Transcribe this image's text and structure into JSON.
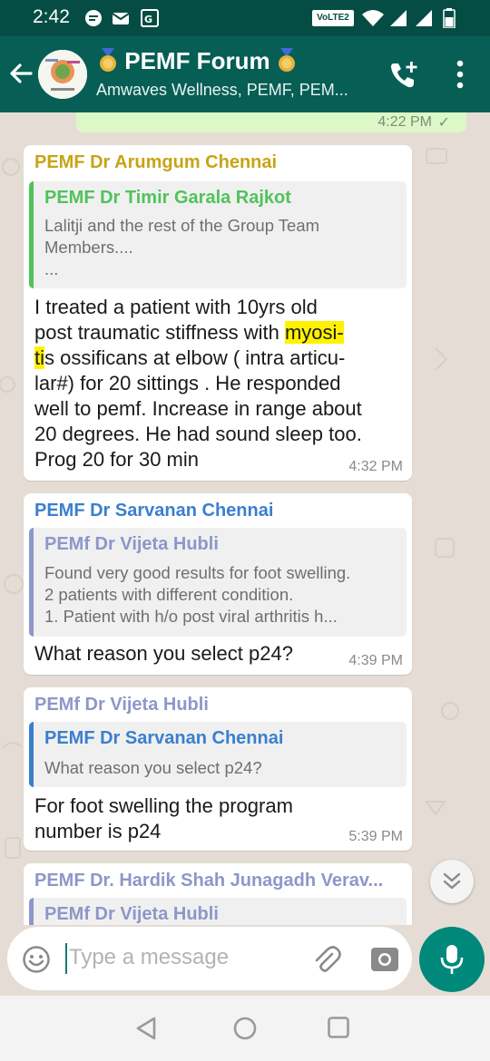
{
  "status_bar": {
    "time": "2:42",
    "network_badge": "VoLTE2"
  },
  "header": {
    "title": "PEMF Forum",
    "subtitle": "Amwaves Wellness, PEMF, PEM..."
  },
  "outgoing_prev": {
    "time": "4:22 PM"
  },
  "messages": [
    {
      "sender": "PEMF Dr Arumgum Chennai",
      "sender_color": "#c8a415",
      "quote": {
        "name": "PEMF Dr Timir Garala Rajkot",
        "name_color": "#4fc35a",
        "lines": [
          "Lalitji and the rest of the Group Team",
          "Members....",
          "..."
        ]
      },
      "body": [
        "I treated a patient with 10yrs old",
        "post traumatic stiffness  with ",
        "myosi-",
        "ti",
        "s ossificans at elbow ( intra articu-",
        "lar#) for 20 sittings . He responded",
        "well to pemf. Increase in range about",
        "20 degrees.  He had sound sleep too.",
        "Prog 20 for 30 min"
      ],
      "time": "4:32 PM"
    },
    {
      "sender": "PEMF Dr Sarvanan Chennai",
      "sender_color": "#3a7fcf",
      "quote": {
        "name": "PEMf Dr Vijeta Hubli",
        "name_color": "#8d97c9",
        "lines": [
          "Found very good results for foot swelling.",
          "2 patients with different condition.",
          "1. Patient with h/o post viral arthritis h..."
        ]
      },
      "body": [
        "What reason you select p24?"
      ],
      "time": "4:39 PM"
    },
    {
      "sender": "PEMf Dr Vijeta Hubli",
      "sender_color": "#8d97c9",
      "quote": {
        "name": "PEMF Dr Sarvanan Chennai",
        "name_color": "#3a7fcf",
        "lines": [
          "What reason you select p24?"
        ]
      },
      "body": [
        "For foot swelling the program",
        "number is p24"
      ],
      "time": "5:39 PM"
    },
    {
      "sender": "PEMF Dr. Hardik Shah Junagadh Verav...",
      "sender_color": "#8d97c9",
      "quote": {
        "name": "PEMf Dr Vijeta Hubli",
        "name_color": "#8d97c9",
        "lines": []
      },
      "body": [],
      "time": ""
    }
  ],
  "composer": {
    "placeholder": "Type a message"
  },
  "colors": {
    "status_bar": "#054d44",
    "header": "#075e54",
    "outgoing_bubble": "#dcf8c6",
    "mic_button": "#00897b",
    "highlight": "#fff200"
  },
  "icons": [
    "back-arrow-icon",
    "medal-icon",
    "add-call-icon",
    "more-vert-icon",
    "emoji-icon",
    "attach-icon",
    "camera-icon",
    "mic-icon",
    "double-chevron-down-icon",
    "nav-back-icon",
    "nav-home-icon",
    "nav-recent-icon"
  ]
}
